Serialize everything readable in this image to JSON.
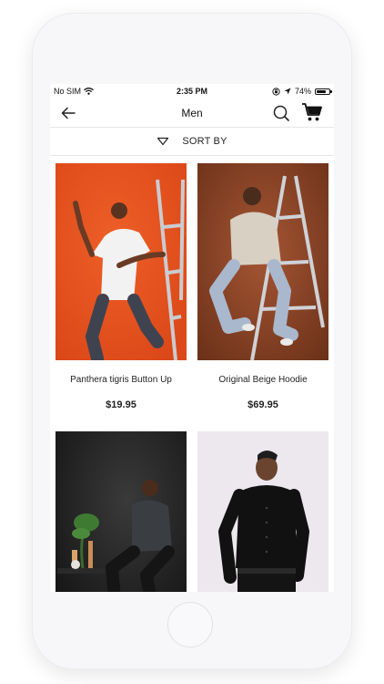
{
  "status_bar": {
    "carrier": "No SIM",
    "time": "2:35 PM",
    "battery_percent": "74%",
    "battery_level": 0.74,
    "wifi_icon": "wifi-icon",
    "lock_icon": "orientation-lock-icon",
    "location_icon": "location-arrow-icon"
  },
  "nav": {
    "title": "Men",
    "back_icon": "back-arrow-icon",
    "search_icon": "search-icon",
    "cart_icon": "cart-icon"
  },
  "sort": {
    "label": "SORT BY",
    "icon": "chevron-down-icon"
  },
  "products": [
    {
      "name": "Panthera tigris Button Up",
      "price": "$19.95",
      "image_desc_color": "#e8501c"
    },
    {
      "name": "Original Beige Hoodie",
      "price": "$69.95",
      "image_desc_color": "#8a4428"
    },
    {
      "name": "",
      "price": "",
      "image_desc_color": "#1c1c1c"
    },
    {
      "name": "",
      "price": "",
      "image_desc_color": "#ece8ee"
    }
  ]
}
